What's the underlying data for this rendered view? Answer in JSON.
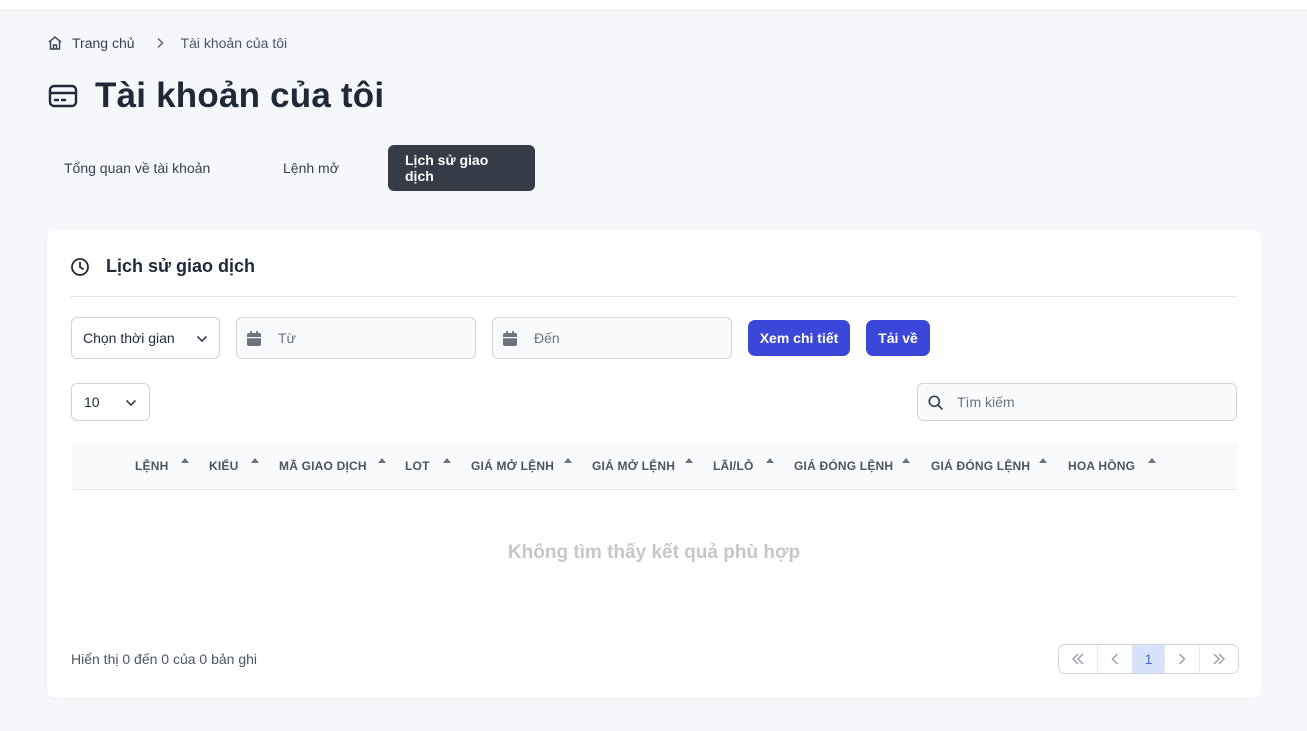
{
  "breadcrumb": {
    "home_label": "Trang chủ",
    "current_label": "Tài khoản của tôi"
  },
  "page": {
    "title": "Tài khoản của tôi"
  },
  "tabs": [
    {
      "label": "Tổng quan về tài khoản",
      "active": false
    },
    {
      "label": "Lệnh mở",
      "active": false
    },
    {
      "label": "Lịch sử giao dịch",
      "active": true
    }
  ],
  "card": {
    "title": "Lịch sử giao dịch"
  },
  "filters": {
    "period_select_value": "Chọn thời gian",
    "from_placeholder": "Từ",
    "to_placeholder": "Đến",
    "view_button": "Xem chi tiết",
    "download_button": "Tải về"
  },
  "table_controls": {
    "page_size": "10",
    "search_placeholder": "Tìm kiếm"
  },
  "table": {
    "columns": [
      "LỆNH",
      "KIỂU",
      "MÃ GIAO DỊCH",
      "LOT",
      "GIÁ MỞ LỆNH",
      "GIÁ MỞ LỆNH",
      "LÃI/LỖ",
      "GIÁ ĐÓNG LỆNH",
      "GIÁ ĐÓNG LỆNH",
      "HOA HỒNG"
    ],
    "empty_message": "Không tìm thấy kết quả phù hợp"
  },
  "footer": {
    "info": "Hiển thị 0 đến 0 của 0 bản ghi",
    "current_page": "1"
  },
  "colors": {
    "accent": "#3b47d9",
    "active_tab": "#353c48",
    "active_page": "#d7e3fb"
  }
}
